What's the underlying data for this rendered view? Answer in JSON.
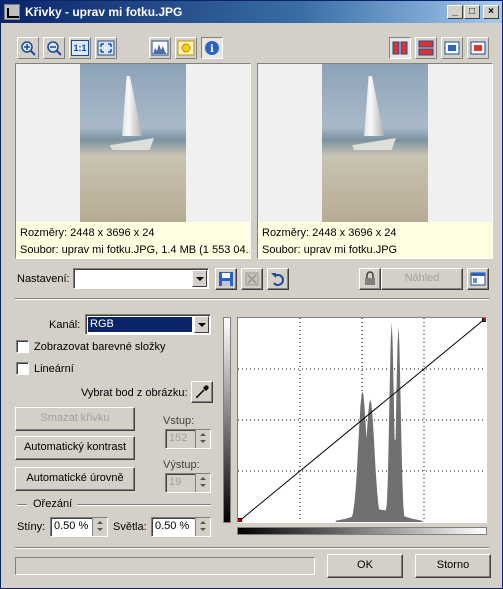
{
  "window": {
    "title": "Křivky - uprav mi fotku.JPG"
  },
  "toolbar": {
    "left_tools": [
      "zoom-in-icon",
      "zoom-out-icon",
      "actual-size-icon",
      "fit-window-icon",
      "histogram-icon",
      "brightness-icon",
      "info-icon"
    ],
    "right_tools": [
      "split-vertical-icon",
      "split-horizontal-icon",
      "single-original-icon",
      "single-result-icon"
    ],
    "actual_size_label": "1:1"
  },
  "previews": {
    "left": {
      "line1": "Rozměry: 2448 x 3696 x 24",
      "line2": "Soubor: uprav mi fotku.JPG, 1.4 MB (1 553 04..."
    },
    "right": {
      "line1": "Rozměry: 2448 x 3696 x 24",
      "line2": "Soubor: uprav mi fotku.JPG"
    }
  },
  "preset": {
    "label": "Nastavení:",
    "value": "",
    "preview_label": "Náhled"
  },
  "channel": {
    "label": "Kanál:",
    "value": "RGB"
  },
  "options": {
    "show_components": "Zobrazovat barevné složky",
    "linear": "Lineární",
    "pick_point": "Vybrat bod z obrázku:"
  },
  "buttons": {
    "delete_curve": "Smazat křivku",
    "auto_contrast": "Automatický kontrast",
    "auto_levels": "Automatické úrovně",
    "ok": "OK",
    "cancel": "Storno"
  },
  "io": {
    "input_label": "Vstup:",
    "input_value": "152",
    "output_label": "Výstup:",
    "output_value": "19"
  },
  "clipping": {
    "title": "Ořezání",
    "shadows_label": "Stíny:",
    "shadows_value": "0.50 %",
    "highlights_label": "Světla:",
    "highlights_value": "0.50 %"
  },
  "curve": {
    "points": [
      [
        0,
        0
      ],
      [
        255,
        255
      ]
    ],
    "histogram_peaks": [
      {
        "at": 128,
        "height": 0.64
      },
      {
        "at": 136,
        "height": 0.6
      },
      {
        "at": 158,
        "height": 0.98
      },
      {
        "at": 165,
        "height": 0.96
      }
    ]
  },
  "colors": {
    "title_start": "#0a246a",
    "control_point": "#d40000"
  }
}
